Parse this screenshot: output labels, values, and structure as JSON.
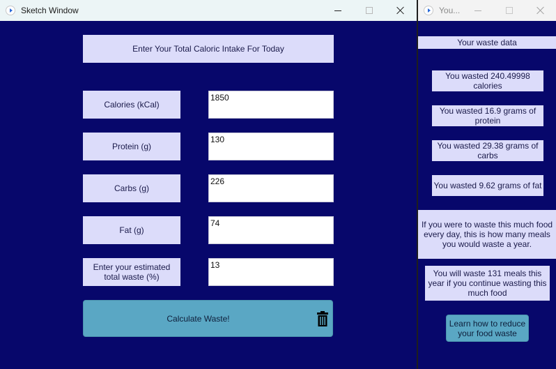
{
  "main_window": {
    "title": "Sketch Window",
    "header": "Enter Your Total Caloric Intake For Today",
    "fields": [
      {
        "label": "Calories (kCal)",
        "value": "1850"
      },
      {
        "label": "Protein (g)",
        "value": "130"
      },
      {
        "label": "Carbs (g)",
        "value": "226"
      },
      {
        "label": "Fat (g)",
        "value": "74"
      },
      {
        "label": "Enter your estimated total waste (%)",
        "value": "13"
      }
    ],
    "calculate_label": "Calculate Waste!",
    "trash_icon": "trash-icon"
  },
  "side_window": {
    "title": "You...",
    "header": "Your waste data",
    "results": [
      "You wasted 240.49998 calories",
      "You wasted 16.9 grams of protein",
      "You wasted 29.38 grams of carbs",
      "You wasted 9.62 grams of fat"
    ],
    "yearly_prompt": "If you were to waste this much food every day, this is how many meals you would waste a year.",
    "meals_result": "You will waste 131 meals this year if you continue wasting this much food",
    "learn_label": "Learn how to reduce your food waste"
  },
  "colors": {
    "background": "#07076b",
    "label_box": "#dcdcfa",
    "button": "#5aa7c4"
  }
}
